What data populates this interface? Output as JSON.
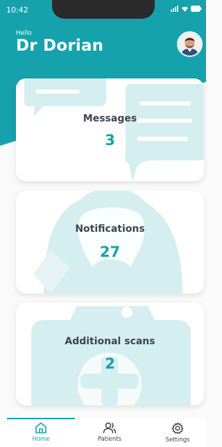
{
  "status_bar": {
    "time": "10:42"
  },
  "header": {
    "greeting": "Hello",
    "doctor_name": "Dr Dorian"
  },
  "cards": [
    {
      "title": "Messages",
      "count": "3"
    },
    {
      "title": "Notifications",
      "count": "27"
    },
    {
      "title": "Additional scans",
      "count": "2"
    }
  ],
  "bottom_nav": [
    {
      "label": "Home",
      "icon": "home-icon",
      "active": true
    },
    {
      "label": "Patients",
      "icon": "users-icon",
      "active": false
    },
    {
      "label": "Settings",
      "icon": "gear-icon",
      "active": false
    }
  ],
  "colors": {
    "accent": "#15a2ad",
    "accent_light": "#d5eef0",
    "text": "#3f4350"
  }
}
